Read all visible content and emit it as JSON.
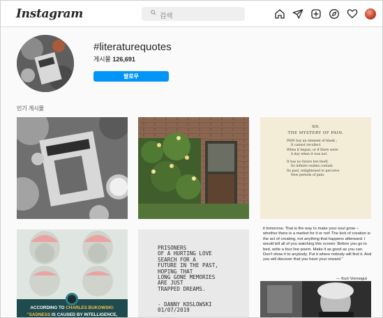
{
  "header": {
    "logo": "Instagram",
    "search_placeholder": "검색",
    "nav_icons": [
      "home-icon",
      "direct-icon",
      "new-post-icon",
      "explore-icon",
      "activity-heart-icon",
      "profile-avatar"
    ]
  },
  "profile": {
    "hashtag": "#literaturequotes",
    "posts_label": "게시물",
    "posts_count": "126,691",
    "follow_label": "팔로우"
  },
  "section": {
    "top_posts_label": "인기 게시물"
  },
  "posts": {
    "p3": {
      "chapter": "XIX.",
      "title": "THE MYSTERY OF PAIN.",
      "stanza1": "PAIN has an element of blank ;\n    It cannot recollect\nWhen it begun, or if there were\n    A day when it was not.",
      "stanza2": "It has no future but itself,\n    Its infinite realms contain\nIts past, enlightened to perceive\n    New periods of pain."
    },
    "p4": {
      "caption1_prefix": "ACCORDING TO ",
      "caption1_name": "CHARLES BUKOWSKI:",
      "caption2_highlight": "\"SADNESS",
      "caption2_rest": " IS CAUSED BY INTELLIGENCE,"
    },
    "p5": {
      "quote": "PRISONERS\nOF A HURTING LOVE\nSEARCH FOR A\nFUTURE IN THE PAST,\nHOPING THAT\nLONG GONE MEMORIES\nARE JUST\nTRAPPED DREAMS.",
      "signature": "- DANNY KOSLOWSKI\n01/07/2019"
    },
    "p6": {
      "text": "it tomorrow. That is the way to make your soul grow – whether there is a market for it or not! The kick of creation is the act of creating, not anything that happens afterward. I would tell all of you watching this screen: Before you go to bed, write a four line poem. Make it as good as you can. Don't show it to anybody. Put it where nobody will find it. And you will discover that you have your reward.\"",
      "author": "— Kurt Vonnegut"
    }
  },
  "colors": {
    "accent": "#0095f6",
    "border": "#dbdbdb",
    "muted": "#8e8e8e"
  }
}
